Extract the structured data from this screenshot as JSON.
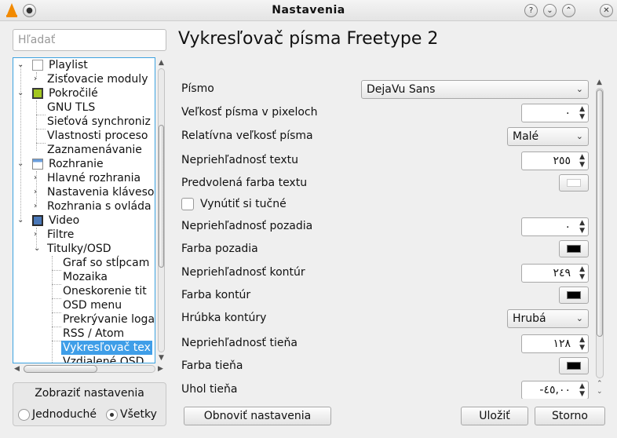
{
  "window": {
    "title": "Nastavenia"
  },
  "search": {
    "placeholder": "Hľadať"
  },
  "tree": {
    "items": [
      {
        "label": "Playlist"
      },
      {
        "label": "Zisťovacie moduly"
      },
      {
        "label": "Pokročilé"
      },
      {
        "label": "GNU TLS"
      },
      {
        "label": "Sieťová synchroniz"
      },
      {
        "label": "Vlastnosti proceso"
      },
      {
        "label": "Zaznamenávanie"
      },
      {
        "label": "Rozhranie"
      },
      {
        "label": "Hlavné rozhrania"
      },
      {
        "label": "Nastavenia kláveso"
      },
      {
        "label": "Rozhrania s ovláda"
      },
      {
        "label": "Video"
      },
      {
        "label": "Filtre"
      },
      {
        "label": "Titulky/OSD"
      },
      {
        "label": "Graf so stĺpcam"
      },
      {
        "label": "Mozaika"
      },
      {
        "label": "Oneskorenie tit"
      },
      {
        "label": "OSD menu"
      },
      {
        "label": "Prekrývanie loga"
      },
      {
        "label": "RSS / Atom"
      },
      {
        "label": "Vykresľovač tex"
      },
      {
        "label": "Vzdialené OSD"
      }
    ]
  },
  "show_settings": {
    "title": "Zobraziť nastavenia",
    "simple": "Jednoduché",
    "all": "Všetky",
    "selected": "all"
  },
  "panel": {
    "title": "Vykresľovač písma Freetype 2",
    "rows": {
      "font": {
        "label": "Písmo",
        "value": "DejaVu Sans"
      },
      "font_size": {
        "label": "Veľkosť písma v pixeloch",
        "value": "٠"
      },
      "rel_size": {
        "label": "Relatívna veľkosť písma",
        "value": "Malé"
      },
      "text_opacity": {
        "label": "Nepriehľadnosť textu",
        "value": "٢٥٥"
      },
      "text_color": {
        "label": "Predvolená farba textu",
        "color": "#ffffff"
      },
      "force_bold": {
        "label": "Vynútiť si tučné",
        "checked": false
      },
      "bg_opacity": {
        "label": "Nepriehľadnosť pozadia",
        "value": "٠"
      },
      "bg_color": {
        "label": "Farba pozadia",
        "color": "#000000"
      },
      "outline_opacity": {
        "label": "Nepriehľadnosť kontúr",
        "value": "٢٤٩"
      },
      "outline_color": {
        "label": "Farba kontúr",
        "color": "#000000"
      },
      "outline_thickness": {
        "label": "Hrúbka kontúry",
        "value": "Hrubá"
      },
      "shadow_opacity": {
        "label": "Nepriehľadnosť tieňa",
        "value": "١٢٨"
      },
      "shadow_color": {
        "label": "Farba tieňa",
        "color": "#000000"
      },
      "shadow_angle": {
        "label": "Uhol tieňa",
        "value": "-٤٥,٠٠"
      }
    }
  },
  "buttons": {
    "reset": "Obnoviť nastavenia",
    "save": "Uložiť",
    "cancel": "Storno"
  },
  "colors": {
    "accent": "#3f9ee8",
    "vlc_orange": "#f28a00"
  }
}
